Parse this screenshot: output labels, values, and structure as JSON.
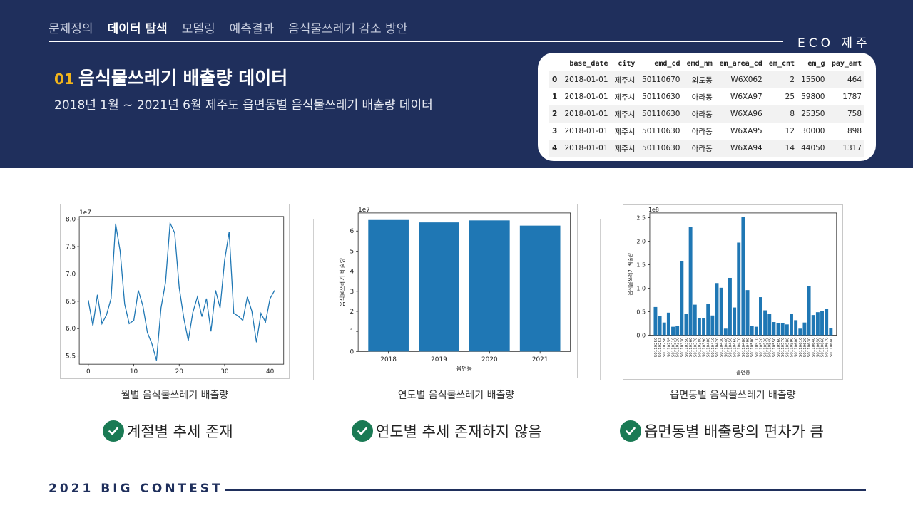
{
  "nav": {
    "items": [
      {
        "label": "문제정의",
        "active": false
      },
      {
        "label": "데이터 탐색",
        "active": true
      },
      {
        "label": "모델링",
        "active": false
      },
      {
        "label": "예측결과",
        "active": false
      },
      {
        "label": "음식물쓰레기 감소 방안",
        "active": false
      }
    ],
    "brand": "ECO 제주"
  },
  "section": {
    "number": "01",
    "title": "음식물쓰레기 배출량 데이터",
    "subtitle": "2018년 1월 ~ 2021년 6월 제주도 읍면동별 음식물쓰레기 배출량 데이터"
  },
  "table": {
    "columns": [
      "",
      "base_date",
      "city",
      "emd_cd",
      "emd_nm",
      "em_area_cd",
      "em_cnt",
      "em_g",
      "pay_amt"
    ],
    "rows": [
      [
        "0",
        "2018-01-01",
        "제주시",
        "50110670",
        "외도동",
        "W6X062",
        "2",
        "15500",
        "464"
      ],
      [
        "1",
        "2018-01-01",
        "제주시",
        "50110630",
        "아라동",
        "W6XA97",
        "25",
        "59800",
        "1787"
      ],
      [
        "2",
        "2018-01-01",
        "제주시",
        "50110630",
        "아라동",
        "W6XA96",
        "8",
        "25350",
        "758"
      ],
      [
        "3",
        "2018-01-01",
        "제주시",
        "50110630",
        "아라동",
        "W6XA95",
        "12",
        "30000",
        "898"
      ],
      [
        "4",
        "2018-01-01",
        "제주시",
        "50110630",
        "아라동",
        "W6XA94",
        "14",
        "44050",
        "1317"
      ]
    ]
  },
  "colors": {
    "header_bg": "#1f2f5c",
    "accent": "#f2b51b",
    "bar": "#1f77b4",
    "check": "#1a7a54"
  },
  "chart_data": [
    {
      "type": "line",
      "title": "",
      "xlabel": "",
      "ylabel": "",
      "offset_label": "1e7",
      "x": [
        0,
        1,
        2,
        3,
        4,
        5,
        6,
        7,
        8,
        9,
        10,
        11,
        12,
        13,
        14,
        15,
        16,
        17,
        18,
        19,
        20,
        21,
        22,
        23,
        24,
        25,
        26,
        27,
        28,
        29,
        30,
        31,
        32,
        33,
        34,
        35,
        36,
        37,
        38,
        39,
        40,
        41
      ],
      "values": [
        6.52,
        6.05,
        6.62,
        6.09,
        6.25,
        6.55,
        7.92,
        7.42,
        6.45,
        6.09,
        6.15,
        6.7,
        6.42,
        5.93,
        5.72,
        5.42,
        6.38,
        6.85,
        7.93,
        7.75,
        6.75,
        6.2,
        5.78,
        6.3,
        6.58,
        6.22,
        6.55,
        5.95,
        6.7,
        6.38,
        7.25,
        7.77,
        6.28,
        6.23,
        6.15,
        6.58,
        6.32,
        5.75,
        6.28,
        6.12,
        6.55,
        6.7
      ],
      "xlim": [
        -2,
        43
      ],
      "ylim": [
        5.35,
        8.05
      ],
      "xticks": [
        0,
        10,
        20,
        30,
        40
      ],
      "yticks": [
        5.5,
        6.0,
        6.5,
        7.0,
        7.5,
        8.0
      ],
      "ytick_labels": [
        "5.5",
        "6.0",
        "6.5",
        "7.0",
        "7.5",
        "8.0"
      ],
      "caption": "월별 음식물쓰레기 배출량",
      "finding": "계절별 추세 존재"
    },
    {
      "type": "bar",
      "title": "",
      "xlabel": "읍면동",
      "ylabel": "음식물쓰레기 배출량",
      "offset_label": "1e7",
      "categories": [
        "2018",
        "2019",
        "2020",
        "2021"
      ],
      "values": [
        6.55,
        6.43,
        6.53,
        6.27
      ],
      "ylim": [
        0,
        6.9
      ],
      "yticks": [
        0,
        1,
        2,
        3,
        4,
        5,
        6
      ],
      "ytick_labels": [
        "0",
        "1",
        "2",
        "3",
        "4",
        "5",
        "6"
      ],
      "caption": "연도별 음식물쓰레기 배출량",
      "finding": "연도별 추세 존재하지 않음"
    },
    {
      "type": "bar",
      "title": "",
      "xlabel": "읍면동",
      "ylabel": "음식물쓰레기 배출량",
      "offset_label": "1e8",
      "categories": [
        "50110250",
        "50110253",
        "50110256",
        "50110259",
        "50110310",
        "50110320",
        "50110330",
        "50110350",
        "50110360",
        "50110370",
        "50110380",
        "50110390",
        "50110400",
        "50110410",
        "50110420",
        "50110430",
        "50110440",
        "50110450",
        "50110460",
        "50110470",
        "50110480",
        "50110490",
        "50110500",
        "50110510",
        "50110520",
        "50110530",
        "50110540",
        "50110550",
        "50110560",
        "50110570",
        "50110580",
        "50110590",
        "50110600",
        "50110610",
        "50110620",
        "50110630",
        "50110640",
        "50110650",
        "50110660",
        "50110670",
        "50110680",
        "50110690",
        "50110700",
        "50110710"
      ],
      "values": [
        0.6,
        0.41,
        0.27,
        0.48,
        0.18,
        0.19,
        1.58,
        0.45,
        2.3,
        0.65,
        0.36,
        0.36,
        0.66,
        0.42,
        1.11,
        1.01,
        0.14,
        1.22,
        0.59,
        1.97,
        2.51,
        0.96,
        0.2,
        0.18,
        0.81,
        0.53,
        0.45,
        0.28,
        0.26,
        0.25,
        0.23,
        0.45,
        0.32,
        0.14,
        0.27,
        1.04,
        0.43,
        0.49,
        0.52,
        0.56,
        0.15
      ],
      "ylim": [
        0,
        2.6
      ],
      "yticks": [
        0,
        0.5,
        1.0,
        1.5,
        2.0,
        2.5
      ],
      "ytick_labels": [
        "0.0",
        "0.5",
        "1.0",
        "1.5",
        "2.0",
        "2.5"
      ],
      "caption": "읍면동별 음식물쓰레기 배출량",
      "finding": "읍면동별 배출량의 편차가 큼"
    }
  ],
  "footer": {
    "text": "2021 BIG CONTEST"
  }
}
